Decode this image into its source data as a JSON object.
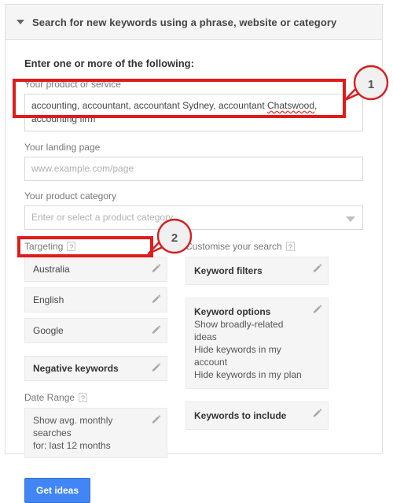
{
  "header": {
    "title": "Search for new keywords using a phrase, website or category",
    "caret_icon": "triangle-down-icon"
  },
  "form": {
    "heading": "Enter one or more of the following:",
    "product_or_service": {
      "label": "Your product or service",
      "value_before_misspelling": "accounting, accountant, accountant Sydney, accountant ",
      "misspelled_word": "Chatswood",
      "value_after_misspelling": ", accounting firm"
    },
    "landing_page": {
      "label": "Your landing page",
      "placeholder": "www.example.com/page",
      "value": ""
    },
    "product_category": {
      "label": "Your product category",
      "placeholder": "Enter or select a product category",
      "value": "",
      "caret_icon": "dropdown-caret-icon"
    }
  },
  "targeting": {
    "label": "Targeting",
    "help_glyph": "?",
    "items": [
      {
        "title": "Australia",
        "bold": false,
        "edit_icon": "pencil-icon"
      },
      {
        "title": "English",
        "bold": false,
        "edit_icon": "pencil-icon"
      },
      {
        "title": "Google",
        "bold": false,
        "edit_icon": "pencil-icon"
      },
      {
        "title": "Negative keywords",
        "bold": true,
        "edit_icon": "pencil-icon"
      }
    ]
  },
  "date_range": {
    "label": "Date Range",
    "help_glyph": "?",
    "card": {
      "line1": "Show avg. monthly searches",
      "line2": "for: last 12 months",
      "edit_icon": "pencil-icon"
    }
  },
  "customise": {
    "label": "Customise your search",
    "help_glyph": "?",
    "keyword_filters": {
      "title": "Keyword filters",
      "edit_icon": "pencil-icon"
    },
    "keyword_options": {
      "title": "Keyword options",
      "options": [
        "Show broadly-related ideas",
        "Hide keywords in my account",
        "Hide keywords in my plan"
      ],
      "edit_icon": "pencil-icon"
    },
    "keywords_to_include": {
      "title": "Keywords to include",
      "edit_icon": "pencil-icon"
    }
  },
  "actions": {
    "get_ideas_label": "Get ideas"
  },
  "annotations": {
    "badge_1": "1",
    "badge_2": "2",
    "highlight_color": "#e01b1b",
    "callout_color": "#d32020"
  },
  "colors": {
    "primary_button": "#4285f4",
    "header_background": "#f5f5f5",
    "card_background": "#f5f5f5",
    "spellcheck_underline": "#d93025"
  }
}
